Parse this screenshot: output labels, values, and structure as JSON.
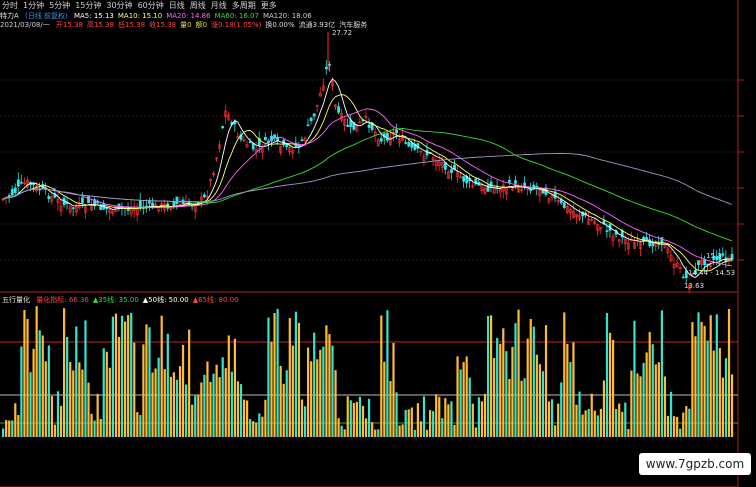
{
  "toolbar": {
    "items": [
      "分时",
      "1分钟",
      "5分钟",
      "15分钟",
      "30分钟",
      "60分钟",
      "日线",
      "周线",
      "月线",
      "多周期",
      "更多"
    ]
  },
  "header": {
    "stock_name": "特力A",
    "period": "(日线 前复权)",
    "ma": [
      {
        "label": "MA5: 15.13",
        "color": "#ffffff"
      },
      {
        "label": "MA10: 15.10",
        "color": "#ffff66"
      },
      {
        "label": "MA20: 14.86",
        "color": "#ff66ff"
      },
      {
        "label": "MA60: 16.07",
        "color": "#33dd33"
      },
      {
        "label": "MA120: 18.06",
        "color": "#cccccc"
      }
    ],
    "date": "2021/03/08/一",
    "quote": [
      {
        "label": "开15.38",
        "color": "#ff4444"
      },
      {
        "label": "高15.38",
        "color": "#ff4444"
      },
      {
        "label": "低15.38",
        "color": "#ff4444"
      },
      {
        "label": "收15.38",
        "color": "#ff4444"
      },
      {
        "label": "量0",
        "color": "#dddd44"
      },
      {
        "label": "额0",
        "color": "#dddd44"
      },
      {
        "label": "涨0.18(1.05%)",
        "color": "#ff4444"
      },
      {
        "label": "换0.00%",
        "color": "#dddddd"
      },
      {
        "label": "流通3.93亿",
        "color": "#dddddd"
      },
      {
        "label": "汽车服务",
        "color": "#dddddd"
      }
    ]
  },
  "price_labels": {
    "high": "27.72",
    "low": "13.63",
    "right_mid": "15.3",
    "range": "14.44 - 14.53"
  },
  "indicator": {
    "title": "五行量化",
    "items": [
      {
        "label": "量化指标: 66.36",
        "color": "#ff4444"
      },
      {
        "label": "▲35线: 35.00",
        "color": "#33dd33"
      },
      {
        "label": "▲50线: 50.00",
        "color": "#ffffff"
      },
      {
        "label": "▲65线: 80.00",
        "color": "#ff4444"
      }
    ]
  },
  "colors": {
    "up": "#ff3333",
    "down": "#33e5e5",
    "bar_high": "#ffbb33",
    "bar_low": "#33e5cc"
  },
  "watermark": "www.7gpzb.com"
}
